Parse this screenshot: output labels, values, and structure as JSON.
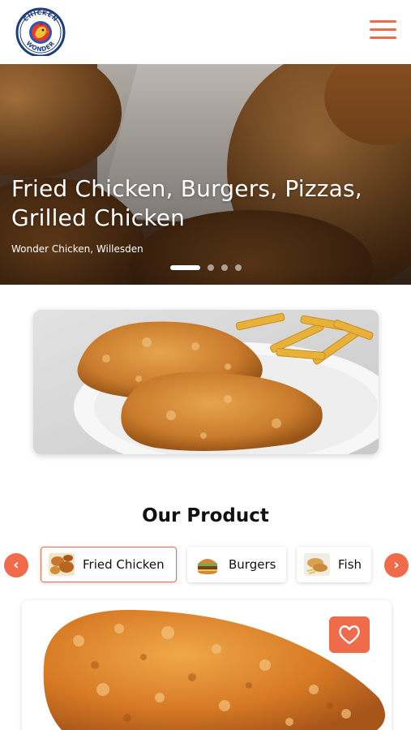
{
  "brand": {
    "logo_text_top": "CHICKEN",
    "logo_text_bottom": "WONDER",
    "accent_color": "#ef6b4b"
  },
  "header": {
    "menu_icon": "hamburger-menu-icon"
  },
  "hero": {
    "title_line1": "Fried Chicken, Burgers, Pizzas,",
    "title_line2": "Grilled Chicken",
    "subtitle": "Wonder Chicken, Willesden",
    "slides": 4,
    "active_slide": 1
  },
  "products": {
    "section_title": "Our Product",
    "prev_icon": "chevron-left-icon",
    "next_icon": "chevron-right-icon",
    "prev_symbol": "‹",
    "next_symbol": "›",
    "categories": [
      {
        "label": "Fried Chicken",
        "active": true
      },
      {
        "label": "Burgers",
        "active": false
      },
      {
        "label": "Fish",
        "active": false
      }
    ],
    "favorite_icon": "heart-icon"
  }
}
